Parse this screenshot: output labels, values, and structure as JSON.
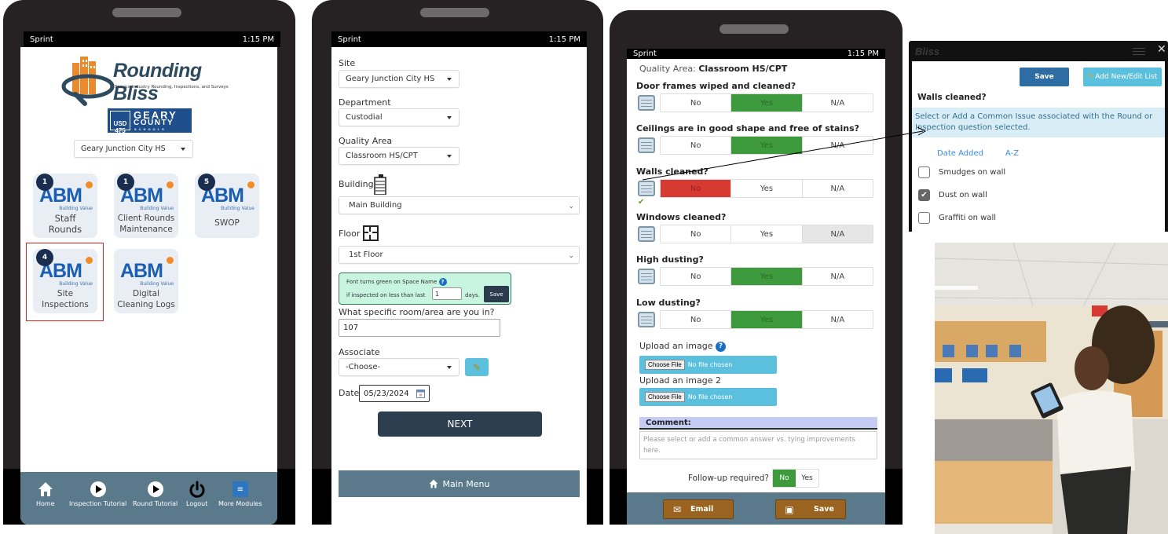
{
  "statusbar": {
    "carrier": "Sprint",
    "time": "1:15 PM"
  },
  "home": {
    "logo_title": "Rounding Bliss",
    "logo_tagline": "Service Industry Rounding, Inspections, and Surveys",
    "district_logo": {
      "usd": "USD 475",
      "line1": "GEARY",
      "line2": "COUNTY",
      "line3": "SCHOOLS"
    },
    "site_select": "Geary Junction City HS",
    "tiles": [
      {
        "brand": "ABM",
        "sub": "Building Value",
        "label": "Staff Rounds",
        "badge": "1"
      },
      {
        "brand": "ABM",
        "sub": "Building Value",
        "label": "Client Rounds Maintenance",
        "badge": "1"
      },
      {
        "brand": "ABM",
        "sub": "Building Value",
        "label": "SWOP",
        "badge": "5"
      },
      {
        "brand": "ABM",
        "sub": "Building Value",
        "label": "Site Inspections",
        "badge": "4",
        "highlighted": true
      },
      {
        "brand": "ABM",
        "sub": "Building Value",
        "label": "Digital Cleaning Logs",
        "badge": ""
      }
    ],
    "nav": [
      {
        "label": "Home",
        "icon": "home-icon"
      },
      {
        "label": "Inspection Tutorial",
        "icon": "play-icon"
      },
      {
        "label": "Round Tutorial",
        "icon": "play-icon"
      },
      {
        "label": "Logout",
        "icon": "power-icon"
      },
      {
        "label": "More Modules",
        "icon": "menu-icon"
      }
    ]
  },
  "form": {
    "site_label": "Site",
    "site_value": "Geary Junction City HS",
    "department_label": "Department",
    "department_value": "Custodial",
    "quality_area_label": "Quality Area",
    "quality_area_value": "Classroom HS/CPT",
    "building_label": "Building",
    "building_value": "Main Building",
    "floor_label": "Floor",
    "floor_value": "1st Floor",
    "info_line1": "Font turns green on Space Name",
    "info_line2": "if inspected on less than last",
    "info_days_value": "1",
    "info_days_label": "days.",
    "info_save": "Save",
    "room_label": "What specific room/area are you in?",
    "room_value": "107",
    "associate_label": "Associate",
    "associate_value": "-Choose-",
    "date_label": "Date",
    "date_value": "05/23/2024",
    "next_button": "NEXT",
    "main_menu": "Main Menu"
  },
  "inspection": {
    "quality_area_prefix": "Quality Area:",
    "quality_area_value": "Classroom HS/CPT",
    "options": [
      "No",
      "Yes",
      "N/A"
    ],
    "questions": [
      {
        "text": "Door frames wiped and cleaned?",
        "answer": "Yes"
      },
      {
        "text": "Ceilings are in good shape and free of stains?",
        "answer": "Yes"
      },
      {
        "text": "Walls cleaned?",
        "answer": "No",
        "has_issue": true
      },
      {
        "text": "Windows cleaned?",
        "answer": "N/A"
      },
      {
        "text": "High dusting?",
        "answer": "Yes"
      },
      {
        "text": "Low dusting?",
        "answer": "Yes"
      }
    ],
    "upload1_label": "Upload an image",
    "upload2_label": "Upload an image 2",
    "choose_file": "Choose File",
    "no_file": "No file chosen",
    "comment_label": "Comment:",
    "comment_placeholder": "Please select or add a common answer vs. tying improvements here.",
    "followup_label": "Follow-up required?",
    "followup_options": [
      "No",
      "Yes"
    ],
    "followup_value": "No",
    "email_button": "Email",
    "save_button": "Save"
  },
  "issue_dialog": {
    "brand": "Bliss",
    "save_button": "Save",
    "add_button": "Add New/Edit List",
    "question": "Walls cleaned?",
    "info": "Select or Add a Common Issue associated with the Round or Inspection question selected.",
    "sort_date": "Date Added",
    "sort_az": "A-Z",
    "issues": [
      {
        "label": "Smudges on wall",
        "checked": false
      },
      {
        "label": "Dust on wall",
        "checked": true
      },
      {
        "label": "Graffiti on wall",
        "checked": false
      }
    ]
  },
  "photo": {
    "alt": "Inspector using a tablet at a nurses' station"
  }
}
